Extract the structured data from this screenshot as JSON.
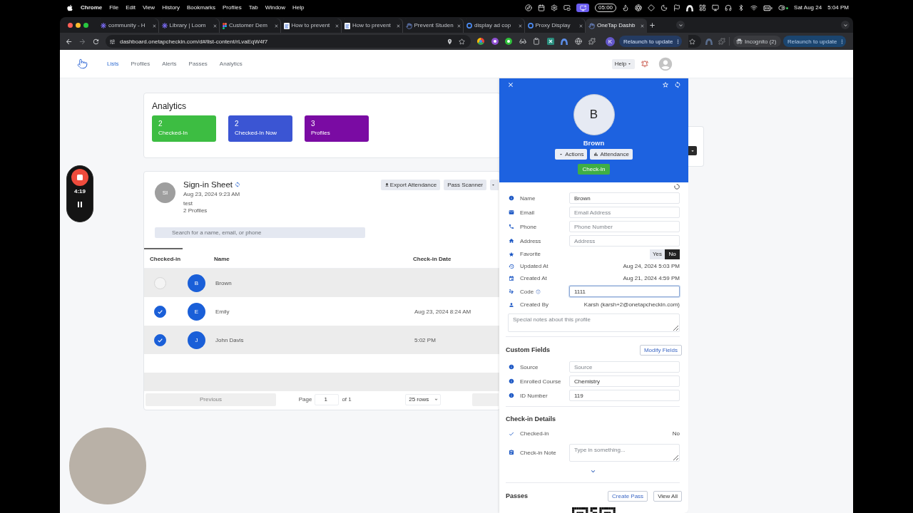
{
  "menu_bar": {
    "app": "Chrome",
    "items": [
      "File",
      "Edit",
      "View",
      "History",
      "Bookmarks",
      "Profiles",
      "Tab",
      "Window",
      "Help"
    ],
    "timer": "05:00",
    "date": "Sat Aug 24",
    "time": "5:04 PM"
  },
  "browser": {
    "tabs": [
      {
        "title": "community - H",
        "selected": false
      },
      {
        "title": "Library | Loom",
        "selected": false
      },
      {
        "title": "Customer Dem",
        "selected": false
      },
      {
        "title": "How to prevent",
        "selected": false
      },
      {
        "title": "How to prevent",
        "selected": false
      },
      {
        "title": "Prevent Studen",
        "selected": false
      },
      {
        "title": "display ad cop",
        "selected": false
      },
      {
        "title": "Proxy Display",
        "selected": false
      },
      {
        "title": "OneTap Dashb",
        "selected": true
      }
    ],
    "url": "dashboard.onetapcheckin.com/d#/list-content/rLvaEqW4f7",
    "profile_initial": "K",
    "update_button": "Relaunch to update"
  },
  "second_window": {
    "incognito": "Incognito (2)",
    "update_button": "Relaunch to update"
  },
  "recorder": {
    "elapsed": "4:19"
  },
  "nav": {
    "items": [
      {
        "label": "Lists",
        "selected": true
      },
      {
        "label": "Profiles",
        "selected": false
      },
      {
        "label": "Alerts",
        "selected": false
      },
      {
        "label": "Passes",
        "selected": false
      },
      {
        "label": "Analytics",
        "selected": false
      }
    ],
    "help": "Help"
  },
  "analytics": {
    "title": "Analytics",
    "tiles": [
      {
        "value": "2",
        "label": "Checked-In",
        "color": "#3dbd42"
      },
      {
        "value": "2",
        "label": "Checked-In Now",
        "color": "#3b55d3"
      },
      {
        "value": "3",
        "label": "Profiles",
        "color": "#7a0ba3"
      }
    ]
  },
  "list": {
    "initials": "SI",
    "title": "Sign-in Sheet",
    "date": "Aug 23, 2024 9:23 AM",
    "description": "test",
    "profiles": "2 Profiles",
    "actions": [
      "Export Attendance",
      "Pass Scanner"
    ],
    "search_placeholder": "Search for a name, email, or phone",
    "columns": [
      {
        "label": "Checked-in",
        "sorted": true
      },
      {
        "label": "Name",
        "sorted": false
      },
      {
        "label": "Check-in Date",
        "sorted": false
      }
    ],
    "rows": [
      {
        "checked": false,
        "initial": "B",
        "name": "Brown"
      },
      {
        "checked": true,
        "initial": "E",
        "name": "Emily",
        "date": "Aug 23, 2024 8:24 AM"
      },
      {
        "checked": true,
        "initial": "J",
        "name": "John Davis",
        "date": "5:02 PM"
      }
    ],
    "pagination": {
      "previous": "Previous",
      "page_label": "Page",
      "page": "1",
      "total": "of 1",
      "page_size": "25 rows"
    }
  },
  "drawer": {
    "initial": "B",
    "name": "Brown",
    "actions": [
      "Actions",
      "Attendance"
    ],
    "check_in": "Check-In",
    "fields": [
      {
        "kind": "input",
        "label": "Name",
        "value": "Brown",
        "focused": false
      },
      {
        "kind": "input",
        "label": "Email",
        "placeholder": "Email Address",
        "focused": false
      },
      {
        "kind": "input",
        "label": "Phone",
        "placeholder": "Phone Number",
        "focused": false
      },
      {
        "kind": "input",
        "label": "Address",
        "placeholder": "Address",
        "focused": false
      },
      {
        "kind": "toggle",
        "label": "Favorite",
        "options": [
          {
            "label": "Yes",
            "selected": false
          },
          {
            "label": "No",
            "selected": true
          }
        ]
      },
      {
        "kind": "text",
        "label": "Updated At",
        "value": "Aug 24, 2024 5:03 PM"
      },
      {
        "kind": "text",
        "label": "Created At",
        "value": "Aug 21, 2024 4:59 PM"
      },
      {
        "kind": "input",
        "label": "Code",
        "value": "1111",
        "focused": true
      },
      {
        "kind": "text",
        "label": "Created By",
        "value": "Karsh (karsh+2@onetapcheckin.com)"
      }
    ],
    "notes_placeholder": "Special notes about this profile",
    "custom_fields": {
      "title": "Custom Fields",
      "button": "Modify Fields",
      "fields": [
        {
          "label": "Source",
          "placeholder": "Source"
        },
        {
          "label": "Enrolled Course",
          "value": "Chemistry"
        },
        {
          "label": "ID Number",
          "value": "119"
        }
      ]
    },
    "check_in_details": {
      "title": "Check-in Details",
      "status_label": "Checked-in",
      "status": "No",
      "note_label": "Check-in Note",
      "note_placeholder": "Type in something..."
    },
    "passes": {
      "title": "Passes",
      "buttons": [
        "Create Pass",
        "View All"
      ]
    }
  }
}
